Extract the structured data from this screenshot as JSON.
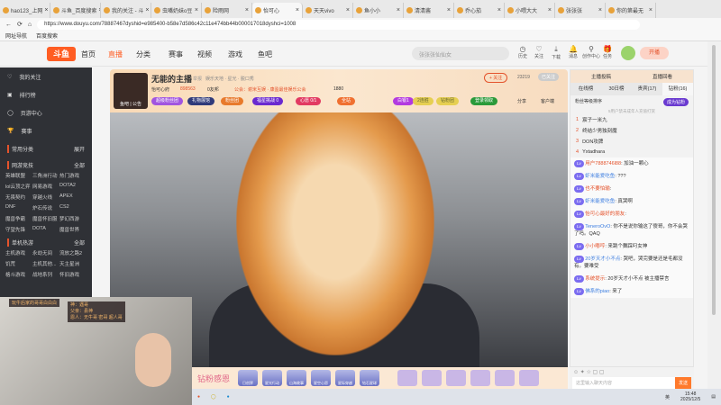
{
  "browser": {
    "tabs": [
      "hao123_上网",
      "斗鱼_百度搜索",
      "我的关注 - 斗",
      "虫嘴奶妹o豆",
      "险雨网",
      "怡可心",
      "天天vivo",
      "鱼小小",
      "清清酱",
      "乔心茄",
      "小喂大大",
      "张张张",
      "你的第最无"
    ],
    "url": "https://www.douyu.com/78887467dyshid=e985400-b58e7d586c42c11e474bb44b000017018dyshci=1008",
    "bookmarks": [
      "网址导航",
      "百度搜索"
    ]
  },
  "header": {
    "logo": "斗鱼",
    "nav": [
      "首页",
      "直播",
      "分类",
      "赛事",
      "视频",
      "游戏",
      "鱼吧"
    ],
    "search_placeholder": "张张张仙仙女",
    "icons": [
      "历史",
      "关注",
      "下载",
      "消息",
      "创作中心",
      "任务"
    ],
    "notif_count": "1",
    "avatar_badge": "11",
    "start_live": "开播"
  },
  "sidebar": {
    "items": [
      "我的关注",
      "排行榜",
      "页游中心",
      "赛事"
    ],
    "common": "常用分类",
    "expand": "展开",
    "sections": [
      {
        "title": "网游竞技",
        "more": "全部",
        "games": [
          "英雄联盟",
          "三角洲行动",
          "热门游戏",
          "lol云顶之弈",
          "网易游戏",
          "DOTA2",
          "无畏契约",
          "穿越火线",
          "APEX",
          "DNF",
          "炉石传说",
          "CS2",
          "魔兽争霸",
          "魔兽怀旧服",
          "梦幻西游",
          "守望先锋",
          "DOTA",
          "魔兽世界"
        ]
      },
      {
        "title": "单机热游",
        "more": "全部",
        "games": [
          "主机游戏",
          "永劫无间",
          "流放之路2",
          "饥荒",
          "主机其他...",
          "天主星洲",
          "格斗游戏",
          "战地系列",
          "怀旧游戏"
        ]
      }
    ]
  },
  "streamer": {
    "name": "无能的主播",
    "report": "举报",
    "category": "娱乐天地 · 星光 · 脱口秀",
    "level": "怡可心府",
    "hot": "898563",
    "fans_group": "0友邦",
    "guild": "公会：谢米互娱 · 康盈最佳娱乐公会",
    "viewers": "1880",
    "badge": "鱼吧 | 公告",
    "pills": [
      "超级粉丝团",
      "礼物展馆",
      "粉丝团",
      "福星挑战 0",
      "心愿 0/1",
      "全站",
      "白银1",
      "2连胜",
      "钻粉团",
      "登录领取"
    ],
    "follow": "+ 关注",
    "follow_count": "23219",
    "followed": "已关注",
    "share": "分享",
    "client": "客户端"
  },
  "cam": {
    "title": "玩牛后家的哥哥白白白",
    "roles": [
      "神：遇哥",
      "父亲：县神",
      "恩人：无牛哥 密哥 超人哥"
    ]
  },
  "gifts": {
    "banner": "钻粉感恩",
    "items": [
      "日创界",
      "星光行动",
      "山海故事",
      "星空心愿",
      "星际穿越",
      "钻石星球"
    ]
  },
  "right": {
    "top_links": [
      "主播投稿",
      "直播回看"
    ],
    "tabs": [
      "在线榜",
      "30日榜",
      "贵宾(17)",
      "钻粉(16)"
    ],
    "sort_label": "粉丝等级排序",
    "become_fan": "成为钻粉",
    "notice": "5用户禁未成年人充值打赏",
    "ranking": [
      {
        "rank": "1",
        "name": "宸子一米九"
      },
      {
        "rank": "2",
        "name": "终结少男独刻魔"
      },
      {
        "rank": "3",
        "name": "DON攻牌"
      },
      {
        "rank": "4",
        "name": "Yxtadhara"
      }
    ],
    "chat": [
      {
        "user": "用户7888746l88",
        "text": "加油一颗心"
      },
      {
        "user": "虾米能爱吃鱼",
        "text": "???"
      },
      {
        "user": "也不要怕输",
        "text": ""
      },
      {
        "user": "虾米能爱吃鱼",
        "text": "真哭啊"
      },
      {
        "user": "怡可心最好的朋友",
        "text": ""
      },
      {
        "user": "TeneroOvO",
        "text": "你不是说你输这了傻哥，你不会哭了吗。QAQ"
      },
      {
        "user": "小小嘟哼",
        "text": "来跳个舞踩叼女神"
      },
      {
        "user": "20岁天才小不点",
        "text": "哭吧，哭完要是还是毛都没有。要难受"
      },
      {
        "user": "系统提示",
        "text": "20岁天才小不点 被主播禁言"
      },
      {
        "user": "佛系的piao",
        "text": "来了"
      }
    ],
    "chat_placeholder": "这里输入聊天内容",
    "send": "发送"
  },
  "taskbar": {
    "time": "15:48",
    "date": "2025/12/5",
    "ime": "英"
  }
}
